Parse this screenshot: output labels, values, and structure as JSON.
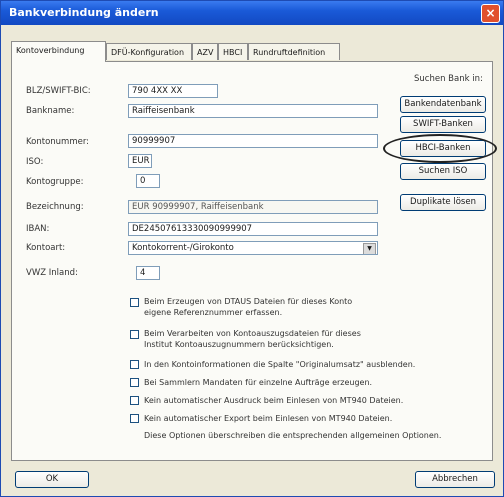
{
  "window": {
    "title": "Bankverbindung ändern",
    "close_glyph": "×"
  },
  "tabs": [
    "Kontoverbindung",
    "DFÜ-Konfiguration",
    "AZV",
    "HBCI",
    "Rundruftdefinition"
  ],
  "form": {
    "blz_label": "BLZ/SWIFT-BIC:",
    "blz_value": "790 4XX XX",
    "bankname_label": "Bankname:",
    "bankname_value": "Raiffeisenbank",
    "konto_label": "Kontonummer:",
    "konto_value": "90999907",
    "iso_label": "ISO:",
    "iso_value": "EUR",
    "gruppe_label": "Kontogruppe:",
    "gruppe_value": "0",
    "bez_label": "Bezeichnung:",
    "bez_value": "EUR 90999907, Raiffeisenbank",
    "iban_label": "IBAN:",
    "iban_value": "DE24507613330090999907",
    "kontoart_label": "Kontoart:",
    "kontoart_value": "Kontokorrent-/Girokonto",
    "vwz_label": "VWZ Inland:",
    "vwz_value": "4"
  },
  "search": {
    "label_line1": "Suchen Bank in:",
    "bank_btn": "Bankendatenbank",
    "swift_btn": "SWIFT-Banken",
    "hbci_btn": "HBCI-Banken",
    "iso_btn": "Suchen ISO",
    "dup_btn": "Duplikate lösen"
  },
  "options": [
    {
      "line1": "Beim Erzeugen von DTAUS Dateien für dieses Konto",
      "line2": "eigene Referenznummer erfassen."
    },
    {
      "line1": "Beim Verarbeiten von Kontoauszugsdateien für dieses",
      "line2": "Institut Kontoauszugnummern berücksichtigen."
    },
    {
      "line1": "In den Kontoinformationen die Spalte \"Originalumsatz\" ausblenden.",
      "line2": ""
    },
    {
      "line1": "Bei Sammlern Mandaten für einzelne Aufträge erzeugen.",
      "line2": ""
    },
    {
      "line1": "Kein automatischer Ausdruck beim Einlesen von MT940 Dateien.",
      "line2": ""
    },
    {
      "line1": "Kein automatischer Export beim Einlesen von MT940 Dateien.",
      "line2": ""
    }
  ],
  "options_note": "Diese Optionen überschreiben die entsprechenden allgemeinen Optionen.",
  "footer": {
    "ok": "OK",
    "cancel": "Abbrechen"
  }
}
